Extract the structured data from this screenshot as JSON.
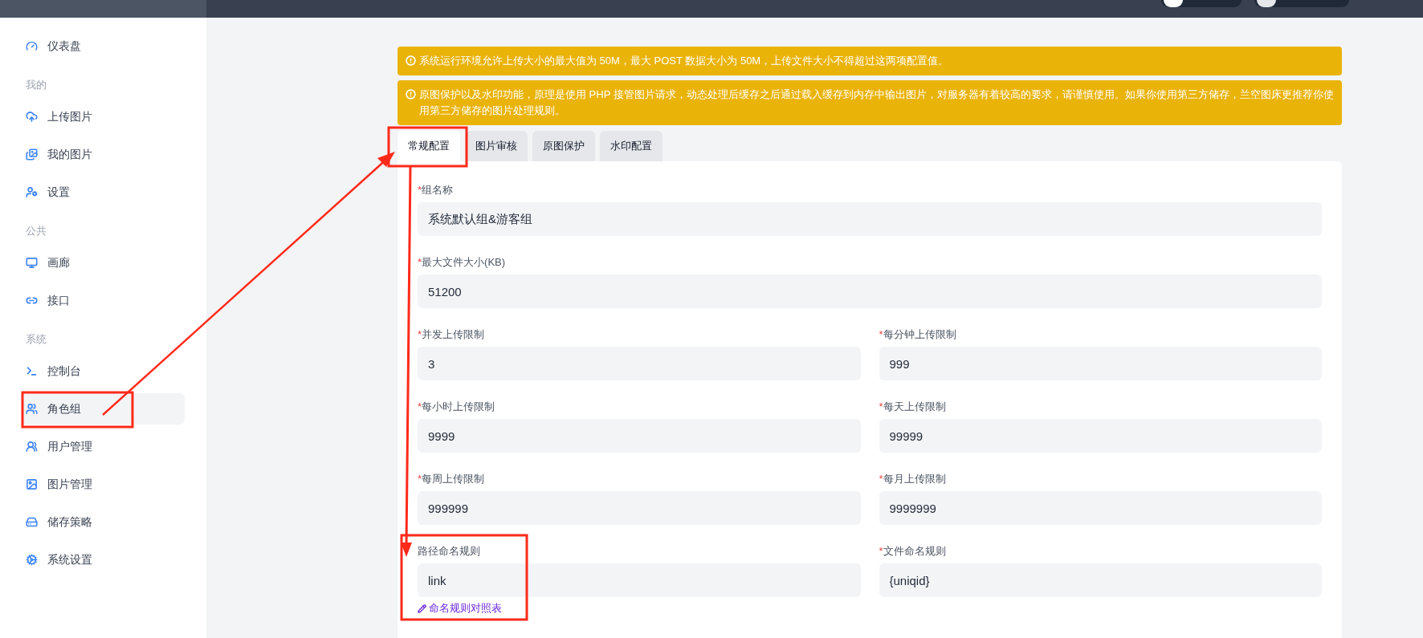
{
  "sidebar": {
    "sections": [
      {
        "items": [
          {
            "label": "仪表盘",
            "selected": false
          }
        ]
      },
      {
        "heading": "我的",
        "items": [
          {
            "label": "上传图片",
            "selected": false
          },
          {
            "label": "我的图片",
            "selected": false
          },
          {
            "label": "设置",
            "selected": false
          }
        ]
      },
      {
        "heading": "公共",
        "items": [
          {
            "label": "画廊",
            "selected": false
          },
          {
            "label": "接口",
            "selected": false
          }
        ]
      },
      {
        "heading": "系统",
        "items": [
          {
            "label": "控制台",
            "selected": false
          },
          {
            "label": "角色组",
            "selected": true
          },
          {
            "label": "用户管理",
            "selected": false
          },
          {
            "label": "图片管理",
            "selected": false
          },
          {
            "label": "储存策略",
            "selected": false
          },
          {
            "label": "系统设置",
            "selected": false
          }
        ]
      }
    ]
  },
  "alerts": [
    {
      "text": "系统运行环境允许上传大小的最大值为 50M，最大 POST 数据大小为 50M，上传文件大小不得超过这两项配置值。"
    },
    {
      "text": "原图保护以及水印功能，原理是使用 PHP 接管图片请求，动态处理后缓存之后通过载入缓存到内存中输出图片，对服务器有着较高的要求，请谨慎使用。如果你使用第三方储存，兰空图床更推荐你使用第三方储存的图片处理规则。"
    }
  ],
  "tabs": [
    {
      "label": "常规配置",
      "selected": true
    },
    {
      "label": "图片审核",
      "selected": false
    },
    {
      "label": "原图保护",
      "selected": false
    },
    {
      "label": "水印配置",
      "selected": false
    }
  ],
  "form": {
    "rows": [
      [
        {
          "required_mark": "*",
          "label": "组名称",
          "value": "系统默认组&游客组"
        }
      ],
      [
        {
          "required_mark": "*",
          "label": "最大文件大小(KB)",
          "value": "51200"
        }
      ],
      [
        {
          "required_mark": "*",
          "label": "并发上传限制",
          "value": "3"
        },
        {
          "required_mark": "*",
          "label": "每分钟上传限制",
          "value": "999"
        }
      ],
      [
        {
          "required_mark": "*",
          "label": "每小时上传限制",
          "value": "9999"
        },
        {
          "required_mark": "*",
          "label": "每天上传限制",
          "value": "99999"
        }
      ],
      [
        {
          "required_mark": "*",
          "label": "每周上传限制",
          "value": "999999"
        },
        {
          "required_mark": "*",
          "label": "每月上传限制",
          "value": "9999999"
        }
      ],
      [
        {
          "label": "路径命名规则",
          "value": "link",
          "link": "命名规则对照表"
        },
        {
          "required_mark": "*",
          "label": "文件命名规则",
          "value": "{uniqid}"
        }
      ]
    ]
  }
}
